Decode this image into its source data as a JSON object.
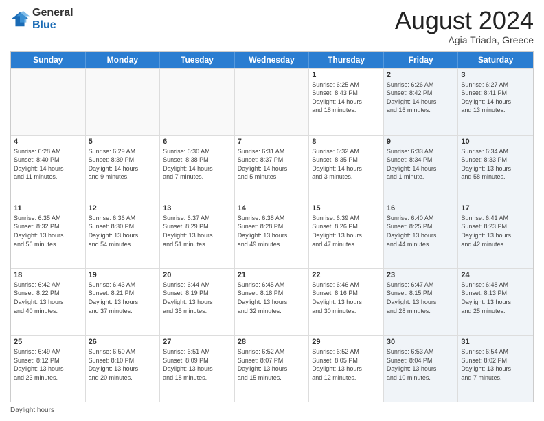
{
  "logo": {
    "general": "General",
    "blue": "Blue"
  },
  "title": "August 2024",
  "location": "Agia Triada, Greece",
  "days_of_week": [
    "Sunday",
    "Monday",
    "Tuesday",
    "Wednesday",
    "Thursday",
    "Friday",
    "Saturday"
  ],
  "footer": "Daylight hours",
  "weeks": [
    [
      {
        "day": "",
        "detail": "",
        "empty": true
      },
      {
        "day": "",
        "detail": "",
        "empty": true
      },
      {
        "day": "",
        "detail": "",
        "empty": true
      },
      {
        "day": "",
        "detail": "",
        "empty": true
      },
      {
        "day": "1",
        "detail": "Sunrise: 6:25 AM\nSunset: 8:43 PM\nDaylight: 14 hours\nand 18 minutes."
      },
      {
        "day": "2",
        "detail": "Sunrise: 6:26 AM\nSunset: 8:42 PM\nDaylight: 14 hours\nand 16 minutes."
      },
      {
        "day": "3",
        "detail": "Sunrise: 6:27 AM\nSunset: 8:41 PM\nDaylight: 14 hours\nand 13 minutes."
      }
    ],
    [
      {
        "day": "4",
        "detail": "Sunrise: 6:28 AM\nSunset: 8:40 PM\nDaylight: 14 hours\nand 11 minutes."
      },
      {
        "day": "5",
        "detail": "Sunrise: 6:29 AM\nSunset: 8:39 PM\nDaylight: 14 hours\nand 9 minutes."
      },
      {
        "day": "6",
        "detail": "Sunrise: 6:30 AM\nSunset: 8:38 PM\nDaylight: 14 hours\nand 7 minutes."
      },
      {
        "day": "7",
        "detail": "Sunrise: 6:31 AM\nSunset: 8:37 PM\nDaylight: 14 hours\nand 5 minutes."
      },
      {
        "day": "8",
        "detail": "Sunrise: 6:32 AM\nSunset: 8:35 PM\nDaylight: 14 hours\nand 3 minutes."
      },
      {
        "day": "9",
        "detail": "Sunrise: 6:33 AM\nSunset: 8:34 PM\nDaylight: 14 hours\nand 1 minute."
      },
      {
        "day": "10",
        "detail": "Sunrise: 6:34 AM\nSunset: 8:33 PM\nDaylight: 13 hours\nand 58 minutes."
      }
    ],
    [
      {
        "day": "11",
        "detail": "Sunrise: 6:35 AM\nSunset: 8:32 PM\nDaylight: 13 hours\nand 56 minutes."
      },
      {
        "day": "12",
        "detail": "Sunrise: 6:36 AM\nSunset: 8:30 PM\nDaylight: 13 hours\nand 54 minutes."
      },
      {
        "day": "13",
        "detail": "Sunrise: 6:37 AM\nSunset: 8:29 PM\nDaylight: 13 hours\nand 51 minutes."
      },
      {
        "day": "14",
        "detail": "Sunrise: 6:38 AM\nSunset: 8:28 PM\nDaylight: 13 hours\nand 49 minutes."
      },
      {
        "day": "15",
        "detail": "Sunrise: 6:39 AM\nSunset: 8:26 PM\nDaylight: 13 hours\nand 47 minutes."
      },
      {
        "day": "16",
        "detail": "Sunrise: 6:40 AM\nSunset: 8:25 PM\nDaylight: 13 hours\nand 44 minutes."
      },
      {
        "day": "17",
        "detail": "Sunrise: 6:41 AM\nSunset: 8:23 PM\nDaylight: 13 hours\nand 42 minutes."
      }
    ],
    [
      {
        "day": "18",
        "detail": "Sunrise: 6:42 AM\nSunset: 8:22 PM\nDaylight: 13 hours\nand 40 minutes."
      },
      {
        "day": "19",
        "detail": "Sunrise: 6:43 AM\nSunset: 8:21 PM\nDaylight: 13 hours\nand 37 minutes."
      },
      {
        "day": "20",
        "detail": "Sunrise: 6:44 AM\nSunset: 8:19 PM\nDaylight: 13 hours\nand 35 minutes."
      },
      {
        "day": "21",
        "detail": "Sunrise: 6:45 AM\nSunset: 8:18 PM\nDaylight: 13 hours\nand 32 minutes."
      },
      {
        "day": "22",
        "detail": "Sunrise: 6:46 AM\nSunset: 8:16 PM\nDaylight: 13 hours\nand 30 minutes."
      },
      {
        "day": "23",
        "detail": "Sunrise: 6:47 AM\nSunset: 8:15 PM\nDaylight: 13 hours\nand 28 minutes."
      },
      {
        "day": "24",
        "detail": "Sunrise: 6:48 AM\nSunset: 8:13 PM\nDaylight: 13 hours\nand 25 minutes."
      }
    ],
    [
      {
        "day": "25",
        "detail": "Sunrise: 6:49 AM\nSunset: 8:12 PM\nDaylight: 13 hours\nand 23 minutes."
      },
      {
        "day": "26",
        "detail": "Sunrise: 6:50 AM\nSunset: 8:10 PM\nDaylight: 13 hours\nand 20 minutes."
      },
      {
        "day": "27",
        "detail": "Sunrise: 6:51 AM\nSunset: 8:09 PM\nDaylight: 13 hours\nand 18 minutes."
      },
      {
        "day": "28",
        "detail": "Sunrise: 6:52 AM\nSunset: 8:07 PM\nDaylight: 13 hours\nand 15 minutes."
      },
      {
        "day": "29",
        "detail": "Sunrise: 6:52 AM\nSunset: 8:05 PM\nDaylight: 13 hours\nand 12 minutes."
      },
      {
        "day": "30",
        "detail": "Sunrise: 6:53 AM\nSunset: 8:04 PM\nDaylight: 13 hours\nand 10 minutes."
      },
      {
        "day": "31",
        "detail": "Sunrise: 6:54 AM\nSunset: 8:02 PM\nDaylight: 13 hours\nand 7 minutes."
      }
    ]
  ]
}
